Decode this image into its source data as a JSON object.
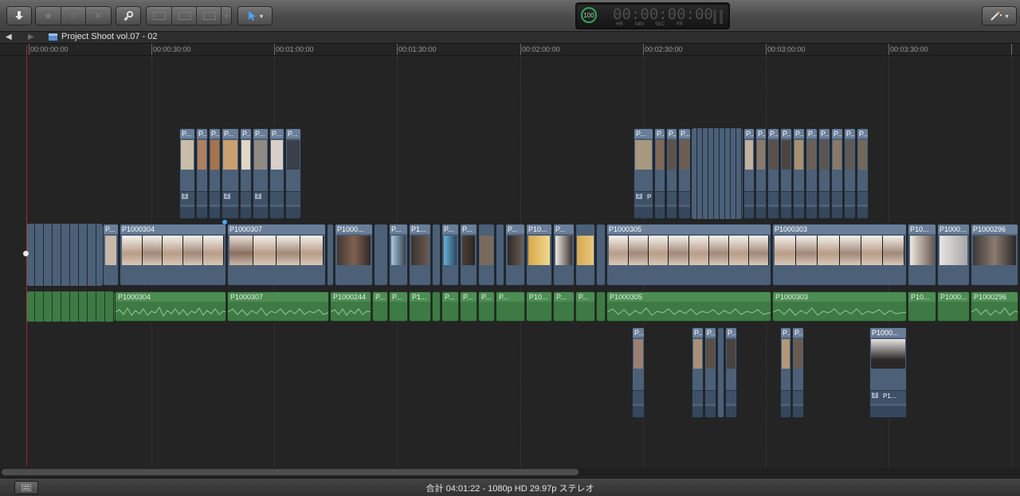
{
  "toolbar": {
    "import_icon": "download-arrow-icon",
    "rate_icons": [
      "favorite-star-icon",
      "unrated-star-icon",
      "reject-x-icon"
    ],
    "keyword_icon": "key-icon",
    "edit_icons": [
      "connect-clip-icon",
      "insert-clip-icon",
      "append-clip-icon"
    ],
    "tool_icon": "arrow-pointer-icon",
    "effects_icon": "magic-wand-icon"
  },
  "timecode": {
    "ring_value": "100",
    "digits": "00:00:00:00",
    "labels": [
      "HR",
      "MIN",
      "SEC",
      "FR"
    ]
  },
  "nav": {
    "project_title": "Project Shoot vol.07 - 02"
  },
  "ruler": [
    "00:00:00:00",
    "00:00:30:00",
    "00:01:00:00",
    "00:01:30:00",
    "00:02:00:00",
    "00:02:30:00",
    "00:03:00:00",
    "00:03:30:00"
  ],
  "primary_clips": [
    "P...",
    "P1000304",
    "P1000307",
    "P1000...",
    "P...",
    "P1...",
    "P...",
    "P...",
    "P...",
    "P10...",
    "P...",
    "P1000305",
    "P1000303",
    "P10...",
    "P1000...",
    "P1000296"
  ],
  "audio_clips": [
    "P1000304",
    "P1000307",
    "P1000244",
    "P...",
    "P1...",
    "P...",
    "P...",
    "P...",
    "P10...",
    "P...",
    "P...",
    "P1000305",
    "P1000303",
    "P10...",
    "P1000...",
    "P1000296"
  ],
  "upper_connected_left": [
    "P...",
    "P...",
    "P...",
    "P...",
    "P...",
    "P...",
    "P...",
    "P..."
  ],
  "upper_connected_right": [
    "P...",
    "P...",
    "P...",
    "P...",
    "P...",
    "P...",
    "P...",
    "P...",
    "P...",
    "P...",
    "P...",
    "P...",
    "P...",
    "P..."
  ],
  "lower_connected": [
    "P...",
    "P...",
    "P...",
    "P...",
    "P...",
    "P...",
    "P1000..."
  ],
  "lower_connected_badge": "P1...",
  "badge_left": "P",
  "status": {
    "summary": "合計 04:01:22 - 1080p HD 29.97p ステレオ"
  },
  "colors": {
    "video_clip": "#4c6078",
    "audio_clip": "#3e7a44",
    "timeline_bg": "#242424"
  }
}
